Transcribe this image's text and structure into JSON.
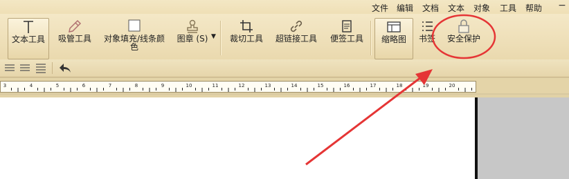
{
  "menu": [
    "文件",
    "编辑",
    "文档",
    "文本",
    "对象",
    "工具",
    "帮助"
  ],
  "toolbar": {
    "text_tool": "文本工具",
    "eyedropper": "吸管工具",
    "fill_line_color_1": "对象填充/线条颜",
    "fill_line_color_2": "色",
    "stamp": "图章 (S)",
    "crop": "裁切工具",
    "hyperlink": "超链接工具",
    "note": "便签工具",
    "thumbnail": "缩略图",
    "bookmark": "书签",
    "security": "安全保护"
  },
  "ruler": {
    "labels": [
      "3",
      "4",
      "5",
      "6",
      "7",
      "8",
      "9",
      "10",
      "11",
      "12",
      "13",
      "14",
      "15",
      "16",
      "17",
      "18",
      "19",
      "20"
    ]
  },
  "colors": {
    "annotation_red": "#e53535"
  }
}
